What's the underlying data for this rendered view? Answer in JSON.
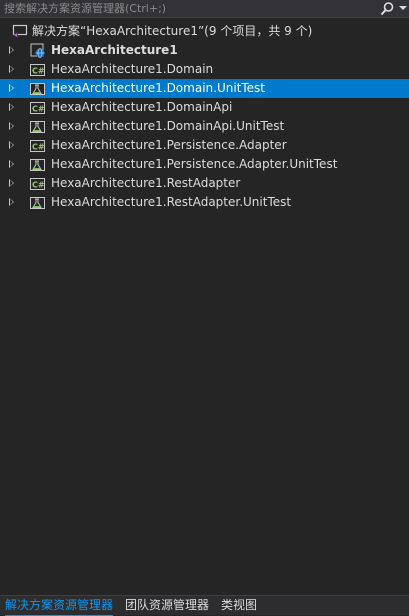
{
  "search": {
    "placeholder": "搜索解决方案资源管理器(Ctrl+;)"
  },
  "solution": {
    "label": "解决方案“HexaArchitecture1”(9 个项目，共 9 个)",
    "icon": "solution-icon"
  },
  "projects": [
    {
      "label": "HexaArchitecture1",
      "icon": "web-project-icon",
      "bold": true
    },
    {
      "label": "HexaArchitecture1.Domain",
      "icon": "csharp-project-icon"
    },
    {
      "label": "HexaArchitecture1.Domain.UnitTest",
      "icon": "test-project-icon",
      "selected": true
    },
    {
      "label": "HexaArchitecture1.DomainApi",
      "icon": "csharp-project-icon"
    },
    {
      "label": "HexaArchitecture1.DomainApi.UnitTest",
      "icon": "test-project-icon"
    },
    {
      "label": "HexaArchitecture1.Persistence.Adapter",
      "icon": "csharp-project-icon"
    },
    {
      "label": "HexaArchitecture1.Persistence.Adapter.UnitTest",
      "icon": "test-project-icon"
    },
    {
      "label": "HexaArchitecture1.RestAdapter",
      "icon": "csharp-project-icon"
    },
    {
      "label": "HexaArchitecture1.RestAdapter.UnitTest",
      "icon": "test-project-icon"
    }
  ],
  "tabs": [
    {
      "label": "解决方案资源管理器",
      "active": true
    },
    {
      "label": "团队资源管理器"
    },
    {
      "label": "类视图"
    }
  ],
  "colors": {
    "background": "#252526",
    "selection": "#007acc",
    "active_tab": "#0e97f0"
  }
}
